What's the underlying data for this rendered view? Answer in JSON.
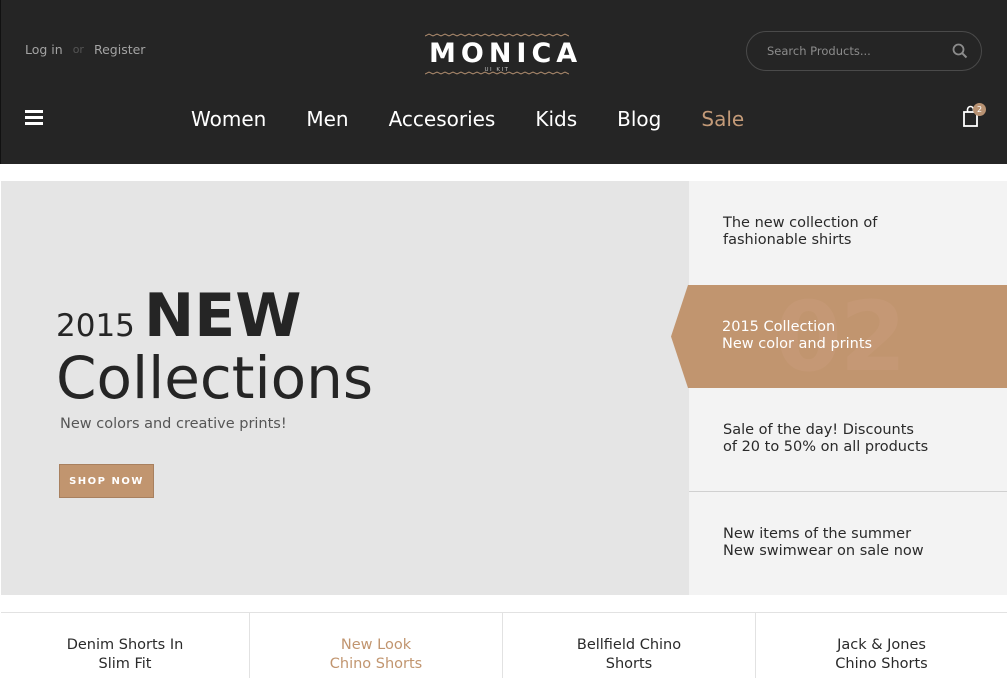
{
  "header": {
    "auth": {
      "login": "Log in",
      "or": "or",
      "register": "Register"
    },
    "logo": {
      "title": "MONICA",
      "subtitle": "UI KIT"
    },
    "search": {
      "placeholder": "Search Products..."
    },
    "nav": [
      {
        "label": "Women"
      },
      {
        "label": "Men"
      },
      {
        "label": "Accesories"
      },
      {
        "label": "Kids"
      },
      {
        "label": "Blog"
      },
      {
        "label": "Sale"
      }
    ],
    "cart": {
      "count": "2"
    }
  },
  "hero": {
    "year": "2015",
    "headline_bold": "NEW",
    "headline_rest": "Collections",
    "subtitle": "New colors and creative prints!",
    "cta": "SHOP NOW"
  },
  "slider": {
    "items": [
      {
        "line1": "The new collection of",
        "line2": "fashionable shirts"
      },
      {
        "number": "02",
        "line1": "2015 Collection",
        "line2": "New color and prints"
      },
      {
        "line1": "Sale of the day! Discounts",
        "line2": "of 20 to 50% on all products"
      },
      {
        "line1": "New items of the summer",
        "line2": "New swimwear on sale now"
      }
    ],
    "active_index": 1
  },
  "products": [
    {
      "line1": "Denim Shorts In",
      "line2": "Slim Fit"
    },
    {
      "line1": "New Look",
      "line2": "Chino Shorts"
    },
    {
      "line1": "Bellfield Chino",
      "line2": "Shorts"
    },
    {
      "line1": "Jack & Jones",
      "line2": "Chino Shorts"
    }
  ],
  "colors": {
    "header_bg": "#252525",
    "accent": "#c1956f",
    "hero_bg": "#e5e5e5",
    "side_bg": "#f3f3f3"
  }
}
